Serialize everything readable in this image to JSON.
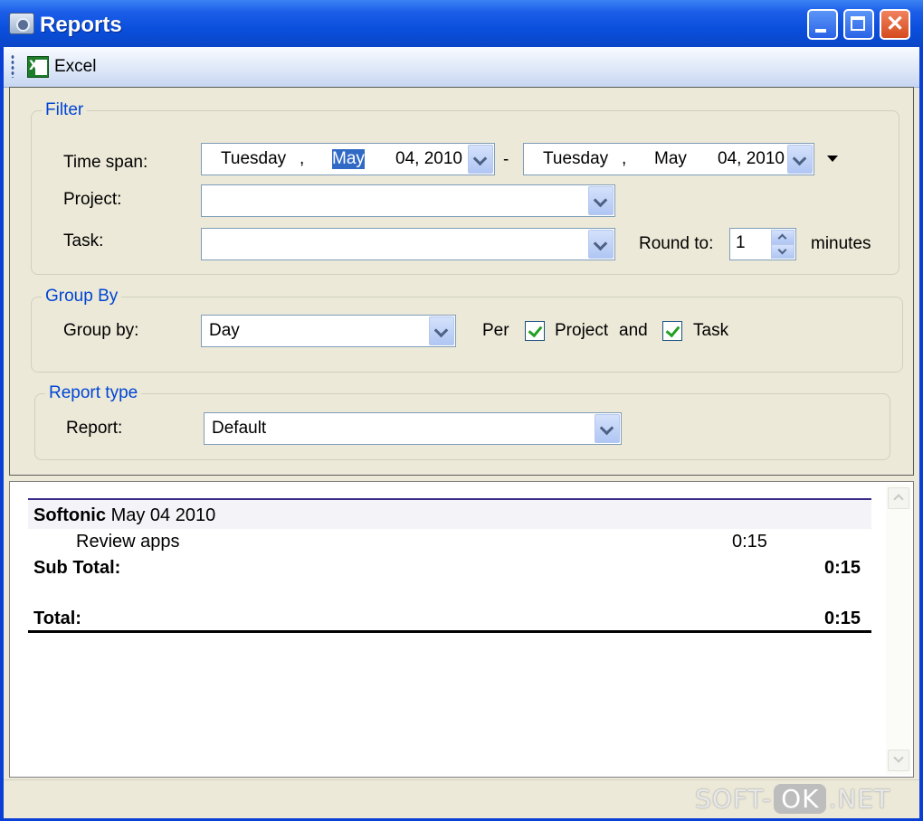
{
  "window": {
    "title": "Reports"
  },
  "toolbar": {
    "excel_label": "Excel"
  },
  "filter": {
    "legend": "Filter",
    "time_span_label": "Time span:",
    "from": {
      "weekday": "Tuesday",
      "sep": ",",
      "month": "May",
      "daydate": "04, 2010"
    },
    "range_sep": "-",
    "to": {
      "weekday": "Tuesday",
      "sep": ",",
      "month": "May",
      "daydate": "04, 2010"
    },
    "project_label": "Project:",
    "project_value": "",
    "task_label": "Task:",
    "task_value": "",
    "round_to_label": "Round to:",
    "round_to_value": "1",
    "minutes_label": "minutes"
  },
  "group_by": {
    "legend": "Group By",
    "label": "Group by:",
    "value": "Day",
    "per_label": "Per",
    "project_checkbox_label": "Project",
    "and_label": "and",
    "task_checkbox_label": "Task",
    "project_checked": true,
    "task_checked": true
  },
  "report_type": {
    "legend": "Report type",
    "label": "Report:",
    "value": "Default"
  },
  "report": {
    "group_name": "Softonic",
    "group_date": "May 04 2010",
    "item_name": "Review apps",
    "item_time": "0:15",
    "subtotal_label": "Sub Total:",
    "subtotal_value": "0:15",
    "total_label": "Total:",
    "total_value": "0:15"
  },
  "watermark": {
    "left": "SOFT-",
    "mid": "OK",
    "right": ".NET"
  },
  "colors": {
    "titlebar": "#0a4fdd",
    "legend_text": "#0046d5",
    "selection": "#316ac5",
    "report_rule": "#3a2a8a"
  }
}
